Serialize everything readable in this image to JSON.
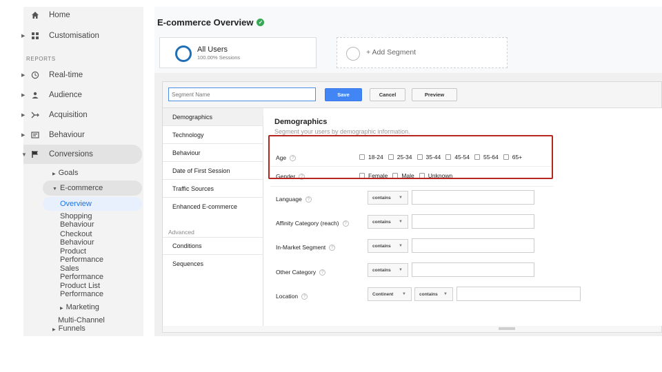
{
  "sidebar": {
    "home": "Home",
    "customisation": "Customisation",
    "reports_heading": "REPORTS",
    "realtime": "Real-time",
    "audience": "Audience",
    "acquisition": "Acquisition",
    "behaviour": "Behaviour",
    "conversions": "Conversions",
    "goals": "Goals",
    "ecommerce": "E-commerce",
    "overview": "Overview",
    "shopping_behaviour_1": "Shopping",
    "shopping_behaviour_2": "Behaviour",
    "checkout_behaviour_1": "Checkout",
    "checkout_behaviour_2": "Behaviour",
    "product_performance_1": "Product",
    "product_performance_2": "Performance",
    "sales_performance_1": "Sales",
    "sales_performance_2": "Performance",
    "product_list_performance_1": "Product List",
    "product_list_performance_2": "Performance",
    "marketing": "Marketing",
    "multichannel_1": "Multi-Channel",
    "multichannel_2": "Funnels"
  },
  "header": {
    "title": "E-commerce Overview"
  },
  "segments": {
    "all_users": "All Users",
    "all_users_sessions": "100.00% Sessions",
    "add_segment": "+ Add Segment"
  },
  "toolbar": {
    "segment_name_placeholder": "Segment Name",
    "save": "Save",
    "cancel": "Cancel",
    "preview": "Preview"
  },
  "builder_nav": {
    "demographics": "Demographics",
    "technology": "Technology",
    "behaviour": "Behaviour",
    "date_of_first_session": "Date of First Session",
    "traffic_sources": "Traffic Sources",
    "enhanced_ecommerce": "Enhanced E-commerce",
    "advanced_heading": "Advanced",
    "conditions": "Conditions",
    "sequences": "Sequences"
  },
  "demographics": {
    "title": "Demographics",
    "description": "Segment your users by demographic information.",
    "age_label": "Age",
    "age_options": [
      "18-24",
      "25-34",
      "35-44",
      "45-54",
      "55-64",
      "65+"
    ],
    "gender_label": "Gender",
    "gender_options": [
      "Female",
      "Male",
      "Unknown"
    ],
    "language_label": "Language",
    "affinity_label": "Affinity Category (reach)",
    "inmarket_label": "In-Market Segment",
    "other_label": "Other Category",
    "location_label": "Location",
    "contains": "contains",
    "continent": "Continent",
    "help_glyph": "?"
  },
  "colors": {
    "accent": "#4285f4",
    "highlight_box": "#b3261e",
    "verified": "#34a853",
    "segment_ring": "#1e6fb8"
  }
}
